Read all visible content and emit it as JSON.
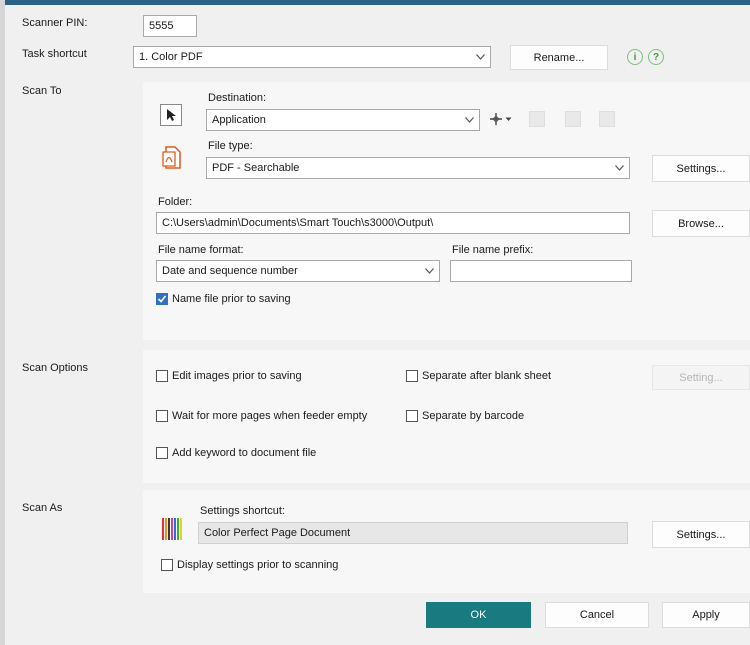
{
  "window": {
    "accent_color": "#197a80"
  },
  "top": {
    "scanner_pin_label": "Scanner PIN:",
    "scanner_pin_value": "5555",
    "task_shortcut_label": "Task shortcut",
    "task_shortcut_value": "1. Color PDF",
    "rename_label": "Rename...",
    "info_glyph": "i",
    "help_glyph": "?"
  },
  "scan_to": {
    "section_label": "Scan To",
    "destination_label": "Destination:",
    "destination_value": "Application",
    "file_type_label": "File type:",
    "file_type_value": "PDF - Searchable",
    "settings_label": "Settings...",
    "folder_label": "Folder:",
    "folder_value": "C:\\Users\\admin\\Documents\\Smart Touch\\s3000\\Output\\",
    "browse_label": "Browse...",
    "file_name_format_label": "File name format:",
    "file_name_format_value": "Date and sequence number",
    "file_name_prefix_label": "File name prefix:",
    "file_name_prefix_value": "",
    "name_file_label": "Name file prior to saving"
  },
  "scan_options": {
    "section_label": "Scan Options",
    "edit_images_label": "Edit images prior to saving",
    "separate_blank_label": "Separate after blank sheet",
    "settings_label": "Setting...",
    "wait_pages_label": "Wait for more pages when feeder empty",
    "separate_barcode_label": "Separate by barcode",
    "add_keyword_label": "Add keyword to document file"
  },
  "scan_as": {
    "section_label": "Scan As",
    "settings_shortcut_label": "Settings shortcut:",
    "settings_shortcut_value": "Color Perfect Page Document",
    "settings_label": "Settings...",
    "display_settings_label": "Display settings prior to scanning"
  },
  "footer": {
    "ok_label": "OK",
    "cancel_label": "Cancel",
    "apply_label": "Apply"
  }
}
